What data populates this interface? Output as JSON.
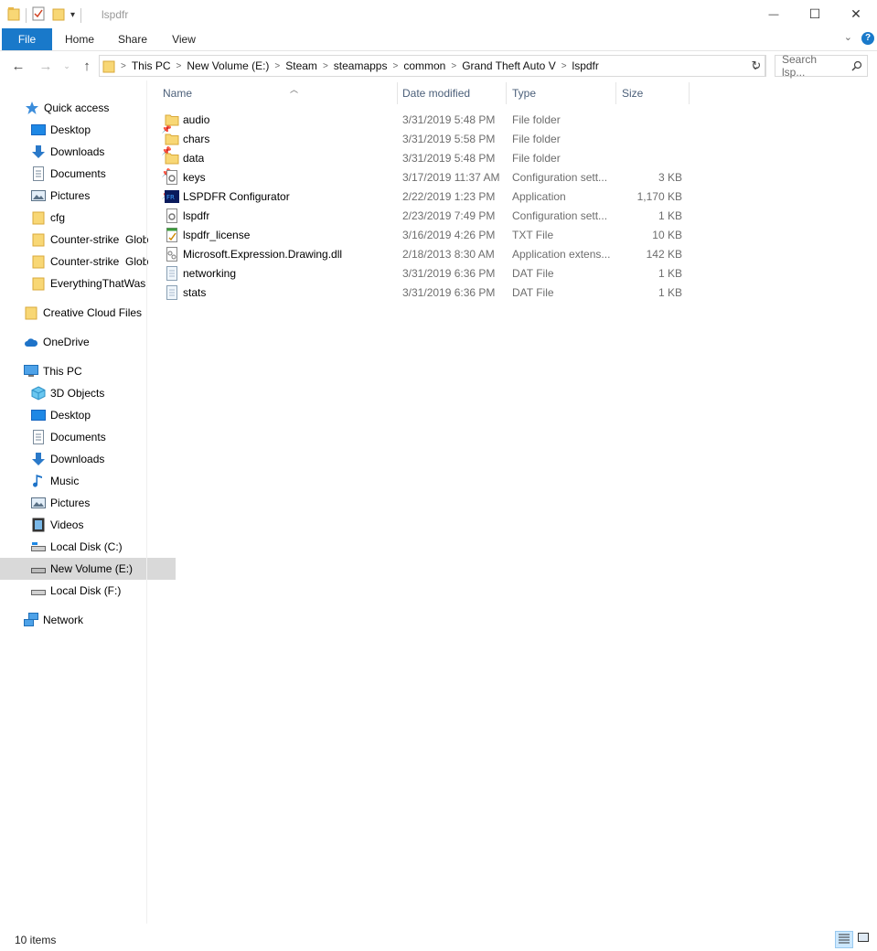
{
  "window": {
    "title": "lspdfr",
    "minimize_glyph": "—",
    "maximize_glyph": "☐",
    "close_glyph": "✕"
  },
  "ribbon": {
    "tabs": [
      "File",
      "Home",
      "Share",
      "View"
    ],
    "help_glyph": "?",
    "collapse_glyph": "⌄"
  },
  "address": {
    "path": [
      "This PC",
      "New Volume (E:)",
      "Steam",
      "steamapps",
      "common",
      "Grand Theft Auto V",
      "lspdfr"
    ],
    "separator": ">",
    "refresh_glyph": "↻",
    "dropdown_glyph": "⌄"
  },
  "search": {
    "placeholder": "Search lsp..."
  },
  "sidebar": {
    "quick_access": {
      "label": "Quick access",
      "items": [
        {
          "label": "Desktop",
          "icon": "desktop-icon",
          "pinned": true
        },
        {
          "label": "Downloads",
          "icon": "downloads-icon",
          "pinned": true
        },
        {
          "label": "Documents",
          "icon": "documents-icon",
          "pinned": true
        },
        {
          "label": "Pictures",
          "icon": "pictures-icon",
          "pinned": true
        },
        {
          "label": "cfg",
          "icon": "folder-icon",
          "pinned": false
        },
        {
          "label": "Counter-strike  Glob",
          "icon": "folder-icon",
          "pinned": false
        },
        {
          "label": "Counter-strike  Glob",
          "icon": "folder-icon",
          "pinned": false
        },
        {
          "label": "EverythingThatWas",
          "icon": "folder-icon",
          "pinned": false
        }
      ]
    },
    "creative_cloud": "Creative Cloud Files",
    "onedrive": "OneDrive",
    "this_pc": {
      "label": "This PC",
      "items": [
        {
          "label": "3D Objects",
          "icon": "3d-objects-icon"
        },
        {
          "label": "Desktop",
          "icon": "desktop-icon"
        },
        {
          "label": "Documents",
          "icon": "documents-icon"
        },
        {
          "label": "Downloads",
          "icon": "downloads-icon"
        },
        {
          "label": "Music",
          "icon": "music-icon"
        },
        {
          "label": "Pictures",
          "icon": "pictures-icon"
        },
        {
          "label": "Videos",
          "icon": "videos-icon"
        },
        {
          "label": "Local Disk (C:)",
          "icon": "drive-icon"
        },
        {
          "label": "New Volume (E:)",
          "icon": "drive-icon",
          "selected": true
        },
        {
          "label": "Local Disk (F:)",
          "icon": "drive-icon"
        }
      ]
    },
    "network": "Network"
  },
  "list": {
    "columns": [
      "Name",
      "Date modified",
      "Type",
      "Size"
    ],
    "files": [
      {
        "name": "audio",
        "date": "3/31/2019 5:48 PM",
        "type": "File folder",
        "size": "",
        "icon": "folder-icon"
      },
      {
        "name": "chars",
        "date": "3/31/2019 5:58 PM",
        "type": "File folder",
        "size": "",
        "icon": "folder-icon"
      },
      {
        "name": "data",
        "date": "3/31/2019 5:48 PM",
        "type": "File folder",
        "size": "",
        "icon": "folder-icon"
      },
      {
        "name": "keys",
        "date": "3/17/2019 11:37 AM",
        "type": "Configuration sett...",
        "size": "3 KB",
        "icon": "config-file-icon"
      },
      {
        "name": "LSPDFR Configurator",
        "date": "2/22/2019 1:23 PM",
        "type": "Application",
        "size": "1,170 KB",
        "icon": "app-icon"
      },
      {
        "name": "lspdfr",
        "date": "2/23/2019 7:49 PM",
        "type": "Configuration sett...",
        "size": "1 KB",
        "icon": "config-file-icon"
      },
      {
        "name": "lspdfr_license",
        "date": "3/16/2019 4:26 PM",
        "type": "TXT File",
        "size": "10 KB",
        "icon": "text-file-icon"
      },
      {
        "name": "Microsoft.Expression.Drawing.dll",
        "date": "2/18/2013 8:30 AM",
        "type": "Application extens...",
        "size": "142 KB",
        "icon": "dll-file-icon"
      },
      {
        "name": "networking",
        "date": "3/31/2019 6:36 PM",
        "type": "DAT File",
        "size": "1 KB",
        "icon": "dat-file-icon"
      },
      {
        "name": "stats",
        "date": "3/31/2019 6:36 PM",
        "type": "DAT File",
        "size": "1 KB",
        "icon": "dat-file-icon"
      }
    ]
  },
  "status": {
    "item_count": "10 items"
  },
  "colors": {
    "accent": "#1979ca",
    "folder": "#f8d775",
    "selected_nav": "#d9d9d9",
    "header_text": "#4c607a"
  }
}
